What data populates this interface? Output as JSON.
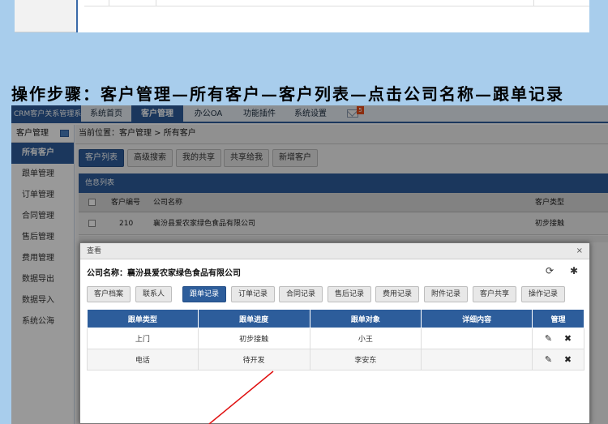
{
  "heading": "操作步骤：客户管理—所有客户—客户列表—点击公司名称—跟单记录",
  "app": {
    "brand": "CRM客户关系管理系统",
    "nav_tabs": [
      "系统首页",
      "客户管理",
      "办公OA",
      "功能插件",
      "系统设置"
    ],
    "active_nav": "客户管理",
    "mail_badge": "5"
  },
  "sidebar": {
    "header": "客户管理",
    "items": [
      "所有客户",
      "跟单管理",
      "订单管理",
      "合同管理",
      "售后管理",
      "费用管理",
      "数据导出",
      "数据导入",
      "系统公海"
    ],
    "active": "所有客户"
  },
  "content": {
    "breadcrumb": "当前位置：客户管理 > 所有客户",
    "toolbar": [
      "客户列表",
      "高级搜索",
      "我的共享",
      "共享给我",
      "新增客户"
    ],
    "info_title": "信息列表",
    "list_headers": [
      "客户编号",
      "公司名称",
      "客户类型"
    ],
    "list_row": {
      "id": "210",
      "company": "襄汾县爱农家绿色食品有限公司",
      "type": "初步接触"
    }
  },
  "modal": {
    "title": "查看",
    "close": "×",
    "company_line": "公司名称：襄汾县爱农家绿色食品有限公司",
    "tabs": [
      "客户档案",
      "联系人",
      "跟单记录",
      "订单记录",
      "合同记录",
      "售后记录",
      "费用记录",
      "附件记录",
      "客户共享",
      "操作记录"
    ],
    "active_tab": "跟单记录",
    "table": {
      "headers": [
        "跟单类型",
        "跟单进度",
        "跟单对象",
        "详细内容",
        "管理"
      ],
      "rows": [
        {
          "type": "上门",
          "progress": "初步接触",
          "target": "小王",
          "detail": ""
        },
        {
          "type": "电话",
          "progress": "待开发",
          "target": "李安东",
          "detail": ""
        }
      ]
    }
  },
  "annotation_color": "#e01010"
}
